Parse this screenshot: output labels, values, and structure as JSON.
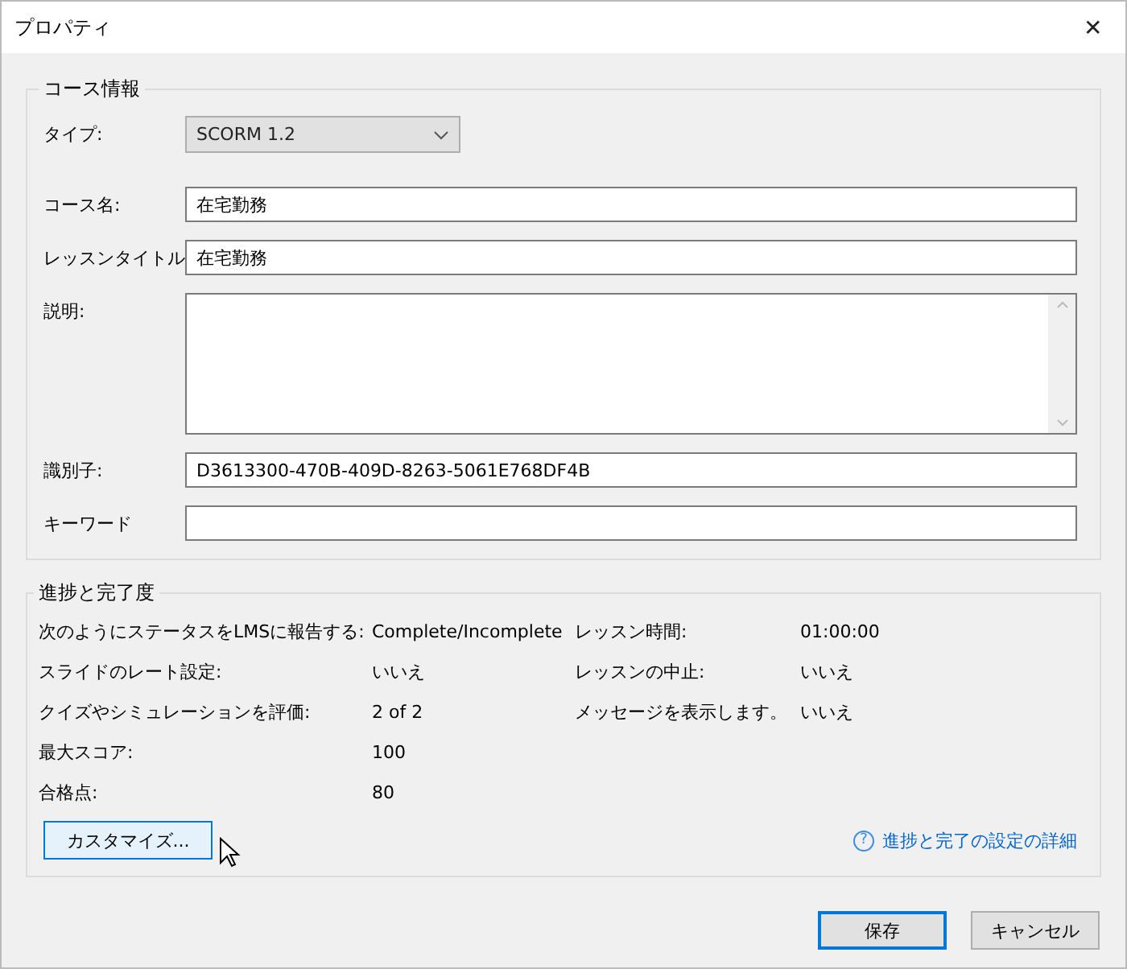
{
  "window": {
    "title": "プロパティ",
    "close": "✕"
  },
  "course_info": {
    "title": "コース情報",
    "fields": [
      {
        "kind": "select",
        "label": "タイプ:",
        "value": "SCORM 1.2"
      },
      {
        "kind": "text",
        "label": "コース名:",
        "value": "在宅勤務"
      },
      {
        "kind": "text",
        "label": "レッスンタイトル",
        "value": "在宅勤務"
      },
      {
        "kind": "textarea",
        "label": "説明:"
      },
      {
        "kind": "text",
        "label": "識別子:",
        "value": "D3613300-470B-409D-8263-5061E768DF4B"
      },
      {
        "kind": "text",
        "label": "キーワード"
      }
    ]
  },
  "progress": {
    "title": "進捗と完了度",
    "left": [
      {
        "label": "次のようにステータスをLMSに報告する:",
        "value": "Complete/Incomplete"
      },
      {
        "label": "スライドのレート設定:",
        "value": "いいえ"
      },
      {
        "label": "クイズやシミュレーションを評価:",
        "value": "2 of 2"
      },
      {
        "label": "最大スコア:",
        "value": "100"
      },
      {
        "label": "合格点:",
        "value": "80"
      }
    ],
    "right": [
      {
        "label": "レッスン時間:",
        "value": "01:00:00"
      },
      {
        "label": "レッスンの中止:",
        "value": "いいえ"
      },
      {
        "label": "メッセージを表示します。",
        "value": "いいえ"
      }
    ],
    "customize_button": "カスタマイズ...",
    "help_icon": "?",
    "help_link": "進捗と完了の設定の詳細"
  },
  "buttons": [
    {
      "label": "保存",
      "default": true
    },
    {
      "label": "キャンセル",
      "default": false
    }
  ]
}
